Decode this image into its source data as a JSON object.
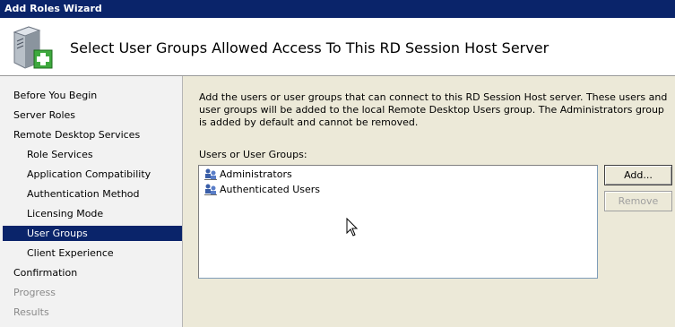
{
  "window": {
    "title": "Add Roles Wizard"
  },
  "header": {
    "title": "Select User Groups Allowed Access To This RD Session Host Server",
    "icon": "server-add-icon"
  },
  "sidebar": {
    "items": [
      {
        "label": "Before You Begin",
        "state": "normal",
        "level": "top"
      },
      {
        "label": "Server Roles",
        "state": "normal",
        "level": "top"
      },
      {
        "label": "Remote Desktop Services",
        "state": "normal",
        "level": "top"
      },
      {
        "label": "Role Services",
        "state": "normal",
        "level": "sub"
      },
      {
        "label": "Application Compatibility",
        "state": "normal",
        "level": "sub"
      },
      {
        "label": "Authentication Method",
        "state": "normal",
        "level": "sub"
      },
      {
        "label": "Licensing Mode",
        "state": "normal",
        "level": "sub"
      },
      {
        "label": "User Groups",
        "state": "selected",
        "level": "sub"
      },
      {
        "label": "Client Experience",
        "state": "normal",
        "level": "sub"
      },
      {
        "label": "Confirmation",
        "state": "normal",
        "level": "top"
      },
      {
        "label": "Progress",
        "state": "disabled",
        "level": "top"
      },
      {
        "label": "Results",
        "state": "disabled",
        "level": "top"
      }
    ]
  },
  "main": {
    "description": "Add the users or user groups that can connect to this RD Session Host server. These users and user groups will be added to the local Remote Desktop Users group. The Administrators group is added by default and cannot be removed.",
    "list_label": "Users or User Groups:",
    "groups": [
      {
        "name": "Administrators",
        "icon": "user-group-icon"
      },
      {
        "name": "Authenticated Users",
        "icon": "user-group-icon"
      }
    ],
    "add_label": "Add...",
    "remove_label": "Remove"
  },
  "colors": {
    "selection": "#0a246a",
    "titlebar": "#0a246a",
    "disabled_text": "#8a8a8a"
  }
}
